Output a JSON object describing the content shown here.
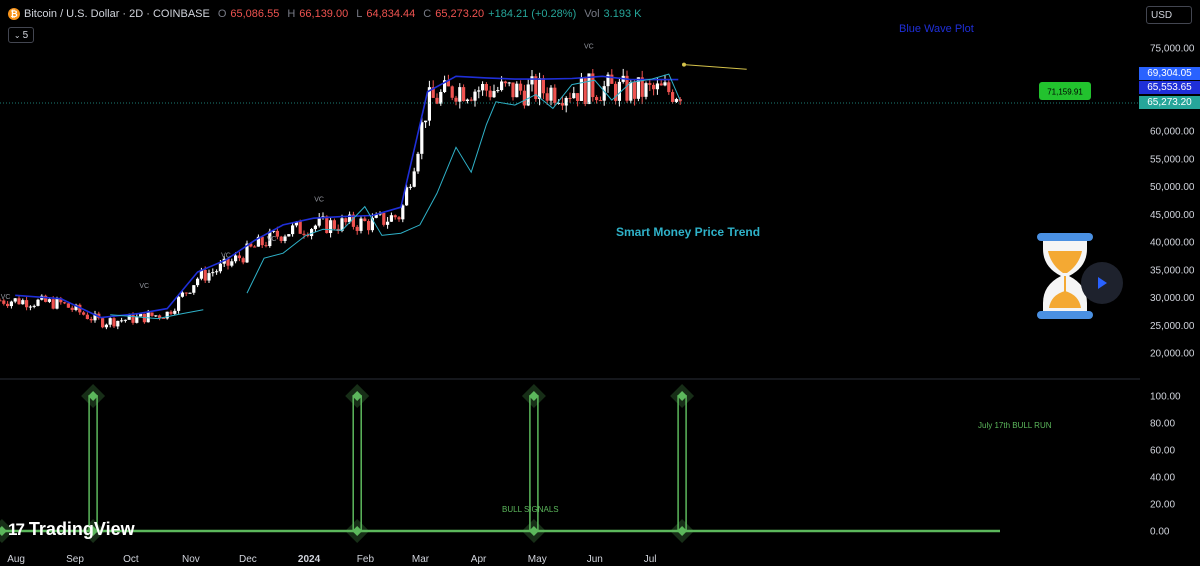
{
  "header": {
    "symbol_title": "Bitcoin / U.S. Dollar · 2D · COINBASE",
    "open_label": "O",
    "open_value": "65,086.55",
    "high_label": "H",
    "high_value": "66,139.00",
    "low_label": "L",
    "low_value": "64,834.44",
    "close_label": "C",
    "close_value": "65,273.20",
    "change": "+184.21 (+0.28%)",
    "volume_label": "Vol",
    "volume_value": "3.193 K",
    "interval_count": "5",
    "currency": "USD"
  },
  "price_labels": {
    "blue_wave_current": "69,304.05",
    "smart_money_current": "65,553.65",
    "last_price": "65,273.20",
    "projection_target": "71,159.91"
  },
  "annotations": {
    "blue_wave_title": "Blue Wave Plot",
    "smart_money_title": "Smart Money Price Trend",
    "bull_signals": "BULL SIGNALS",
    "july_bull_run": "July 17th BULL RUN",
    "vc_marker": "VC"
  },
  "brand": {
    "name": "TradingView"
  },
  "icons": {
    "hourglass": "hourglass-icon",
    "play": "play-icon",
    "bitcoin": "bitcoin-icon",
    "chevron": "chevron-down-icon"
  },
  "colors": {
    "background": "#000000",
    "up_candle": "#ffffff",
    "down_candle": "#ef5350",
    "blue_wave": "#1f2fd8",
    "smart_money": "#2fb2c9",
    "signal": "#5cb85c",
    "projection": "#d4c24a",
    "target_label": "#22c22e"
  },
  "chart_data": [
    {
      "type": "candlestick",
      "title": "Bitcoin / U.S. Dollar · 2D · COINBASE",
      "ylim": [
        18000,
        78000
      ],
      "y_ticks": [
        75000,
        70000,
        65000,
        60000,
        55000,
        50000,
        45000,
        40000,
        35000,
        30000,
        25000,
        20000
      ],
      "y_tick_labels": [
        "75,000.00",
        "70,000.00",
        "65,000.00",
        "60,000.00",
        "55,000.00",
        "50,000.00",
        "45,000.00",
        "40,000.00",
        "35,000.00",
        "30,000.00",
        "25,000.00",
        "20,000.00"
      ],
      "x_tick_labels": [
        "Aug",
        "Sep",
        "Oct",
        "Nov",
        "Dec",
        "2024",
        "Feb",
        "Mar",
        "Apr",
        "May",
        "Jun",
        "Jul"
      ],
      "grid": false,
      "series": [
        {
          "name": "Blue Wave Plot",
          "x": [
            "2023-08-01",
            "2023-08-25",
            "2023-09-15",
            "2023-10-05",
            "2023-10-20",
            "2023-11-05",
            "2023-11-20",
            "2023-12-05",
            "2023-12-20",
            "2024-01-05",
            "2024-01-20",
            "2024-02-05",
            "2024-02-20",
            "2024-03-05",
            "2024-03-20",
            "2024-04-05",
            "2024-04-20",
            "2024-05-05",
            "2024-05-20",
            "2024-06-05",
            "2024-06-20",
            "2024-07-05",
            "2024-07-15"
          ],
          "values": [
            30400,
            29800,
            26400,
            27100,
            28000,
            34600,
            36800,
            40300,
            43100,
            44300,
            44600,
            44800,
            46300,
            67100,
            69900,
            69600,
            69400,
            69400,
            69500,
            69900,
            69300,
            69300,
            69304
          ]
        },
        {
          "name": "Smart Money Price Trend",
          "segments": [
            {
              "x": [
                "2023-09-20",
                "2023-10-01",
                "2023-10-15",
                "2023-10-28",
                "2023-11-08"
              ],
              "values": [
                26900,
                26600,
                26200,
                27100,
                27800
              ]
            },
            {
              "x": [
                "2023-12-01",
                "2023-12-10",
                "2023-12-20",
                "2024-01-01",
                "2024-01-10",
                "2024-01-20",
                "2024-02-01",
                "2024-02-10",
                "2024-02-20",
                "2024-03-01",
                "2024-03-10",
                "2024-03-20",
                "2024-03-28",
                "2024-04-05",
                "2024-04-10",
                "2024-04-20",
                "2024-05-01",
                "2024-05-10",
                "2024-05-20",
                "2024-06-01",
                "2024-06-10",
                "2024-06-20",
                "2024-07-01",
                "2024-07-10",
                "2024-07-16"
              ],
              "values": [
                30800,
                37100,
                38000,
                41200,
                42300,
                42100,
                46400,
                41200,
                41600,
                43100,
                48800,
                57100,
                52600,
                61200,
                65300,
                64700,
                66600,
                64100,
                68400,
                69200,
                65600,
                68800,
                69400,
                70300,
                65554
              ]
            }
          ]
        }
      ],
      "last_price": 65273.2,
      "projection": {
        "from": {
          "x": "2024-07-18",
          "y": 72000
        },
        "to": {
          "x": "2024-08-20",
          "y": 71159.91
        }
      }
    },
    {
      "type": "signal",
      "title": "",
      "ylim": [
        0,
        100
      ],
      "y_ticks": [
        100,
        80,
        60,
        40,
        20,
        0
      ],
      "y_tick_labels": [
        "100.00",
        "80.00",
        "60.00",
        "40.00",
        "20.00",
        "0.00"
      ],
      "x": [
        "2023-07-25",
        "2023-09-11",
        "2024-01-28",
        "2024-04-30",
        "2024-07-17"
      ],
      "values": [
        0,
        100,
        100,
        100,
        100
      ],
      "labels": [
        "BULL SIGNALS",
        "July 17th BULL RUN"
      ]
    }
  ]
}
